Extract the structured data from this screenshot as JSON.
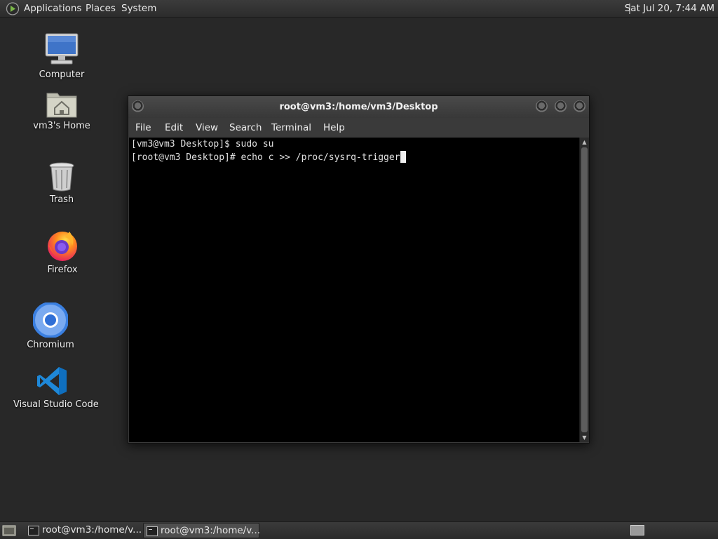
{
  "top_panel": {
    "menus": [
      "Applications",
      "Places",
      "System"
    ],
    "clock": "Sat Jul 20,  7:44 AM"
  },
  "desktop": {
    "icons": [
      {
        "label": "Computer",
        "icon": "computer-icon"
      },
      {
        "label": "vm3's Home",
        "icon": "home-folder-icon"
      },
      {
        "label": "Trash",
        "icon": "trash-icon"
      },
      {
        "label": "Firefox",
        "icon": "firefox-icon"
      },
      {
        "label": "Chromium",
        "icon": "chromium-icon"
      },
      {
        "label": "Visual Studio Code",
        "icon": "vscode-icon"
      }
    ]
  },
  "terminal": {
    "title": "root@vm3:/home/vm3/Desktop",
    "menu": [
      "File",
      "Edit",
      "View",
      "Search",
      "Terminal",
      "Help"
    ],
    "lines": [
      "[vm3@vm3 Desktop]$ sudo su",
      "[root@vm3 Desktop]# echo c >> /proc/sysrq-trigger"
    ]
  },
  "taskbar": {
    "tasks": [
      {
        "label": "root@vm3:/home/v...",
        "active": false
      },
      {
        "label": "root@vm3:/home/v...",
        "active": true
      }
    ]
  },
  "colors": {
    "desktop_bg": "#282828",
    "terminal_bg": "#000000",
    "vscode_blue": "#1e88d8",
    "chromium_blue": "#3a7fe0"
  }
}
